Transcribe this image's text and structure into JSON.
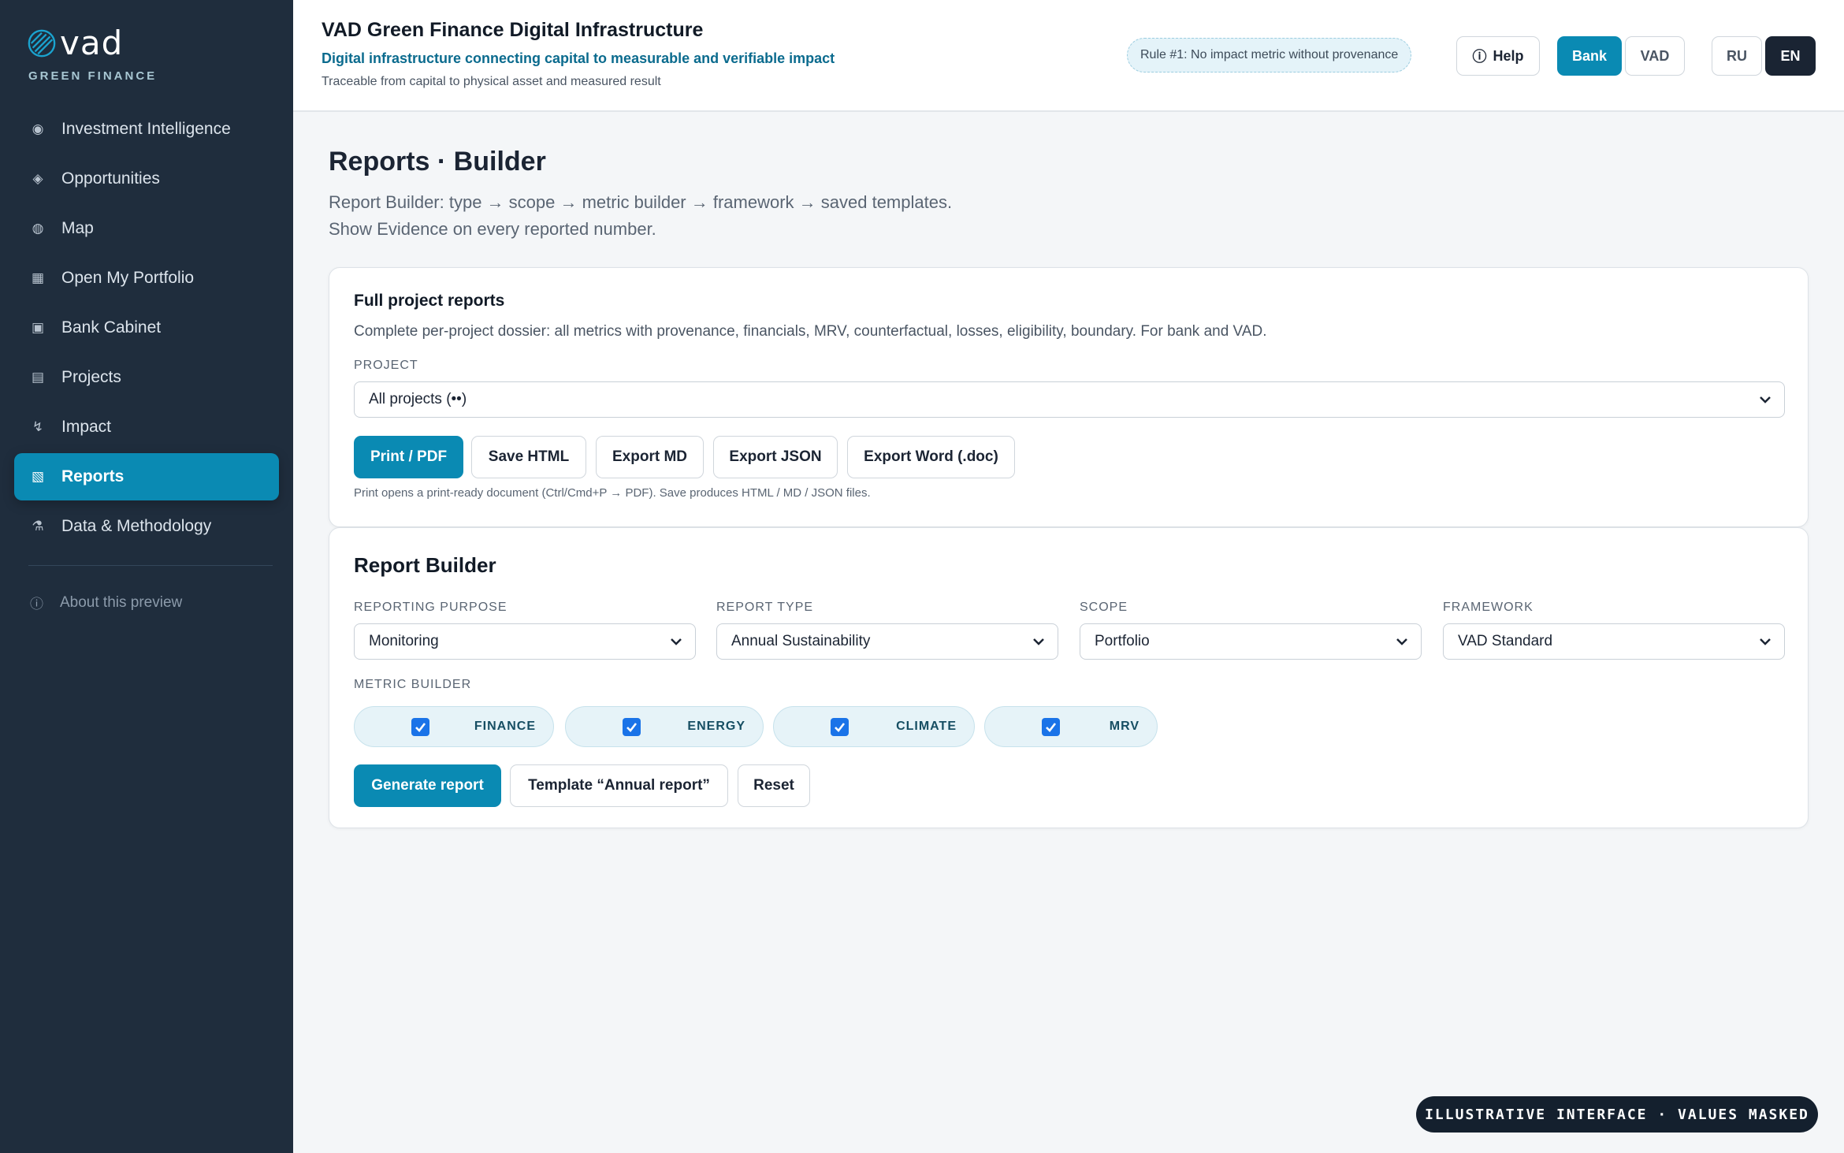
{
  "brand": {
    "name": "vad",
    "subtitle": "GREEN FINANCE"
  },
  "sidebar": {
    "items": [
      {
        "label": "Investment Intelligence",
        "icon": "target-icon",
        "glyph": "◉"
      },
      {
        "label": "Opportunities",
        "icon": "diamond-icon",
        "glyph": "◈"
      },
      {
        "label": "Map",
        "icon": "globe-icon",
        "glyph": "◍"
      },
      {
        "label": "Open My Portfolio",
        "icon": "grid-icon",
        "glyph": "▦"
      },
      {
        "label": "Bank Cabinet",
        "icon": "square-icon",
        "glyph": "▣"
      },
      {
        "label": "Projects",
        "icon": "list-icon",
        "glyph": "▤"
      },
      {
        "label": "Impact",
        "icon": "bolt-icon",
        "glyph": "↯"
      },
      {
        "label": "Reports",
        "icon": "report-icon",
        "glyph": "▧",
        "active": true
      },
      {
        "label": "Data & Methodology",
        "icon": "flask-icon",
        "glyph": "⚗"
      }
    ],
    "about": {
      "label": "About this preview",
      "glyph": "ⓘ"
    }
  },
  "header": {
    "title": "VAD Green Finance Digital Infrastructure",
    "subtitle": "Digital infrastructure connecting capital to measurable and verifiable impact",
    "tagline": "Traceable from capital to physical asset and measured result",
    "rule": "Rule #1: No impact metric without provenance",
    "help_label": "Help",
    "role_bank": "Bank",
    "role_vad": "VAD",
    "lang_ru": "RU",
    "lang_en": "EN"
  },
  "page": {
    "title": "Reports · Builder",
    "desc_line1": "Report Builder: type → scope → metric builder → framework → saved templates.",
    "desc_line2": "Show Evidence on every reported number."
  },
  "full_reports": {
    "title": "Full project reports",
    "description": "Complete per-project dossier: all metrics with provenance, financials, MRV, counterfactual, losses, eligibility, boundary. For bank and VAD.",
    "project_label": "PROJECT",
    "project_value": "All projects (••)",
    "buttons": {
      "print": "Print / PDF",
      "save_html": "Save HTML",
      "export_md": "Export MD",
      "export_json": "Export JSON",
      "export_word": "Export Word (.doc)"
    },
    "note": "Print opens a print-ready document (Ctrl/Cmd+P → PDF). Save produces HTML / MD / JSON files."
  },
  "builder": {
    "title": "Report Builder",
    "purpose_label": "REPORTING PURPOSE",
    "purpose_value": "Monitoring",
    "type_label": "REPORT TYPE",
    "type_value": "Annual Sustainability",
    "scope_label": "SCOPE",
    "scope_value": "Portfolio",
    "framework_label": "FRAMEWORK",
    "framework_value": "VAD Standard",
    "metric_label": "METRIC BUILDER",
    "metrics": [
      {
        "label": "FINANCE",
        "checked": true
      },
      {
        "label": "ENERGY",
        "checked": true
      },
      {
        "label": "CLIMATE",
        "checked": true
      },
      {
        "label": "MRV",
        "checked": true
      }
    ],
    "generate_label": "Generate report",
    "template_label": "Template “Annual report”",
    "reset_label": "Reset"
  },
  "watermark": "ILLUSTRATIVE INTERFACE · VALUES MASKED",
  "colors": {
    "accent": "#0a8ab3",
    "sidebar": "#1f2d3d",
    "checkbox": "#1a73e8"
  }
}
